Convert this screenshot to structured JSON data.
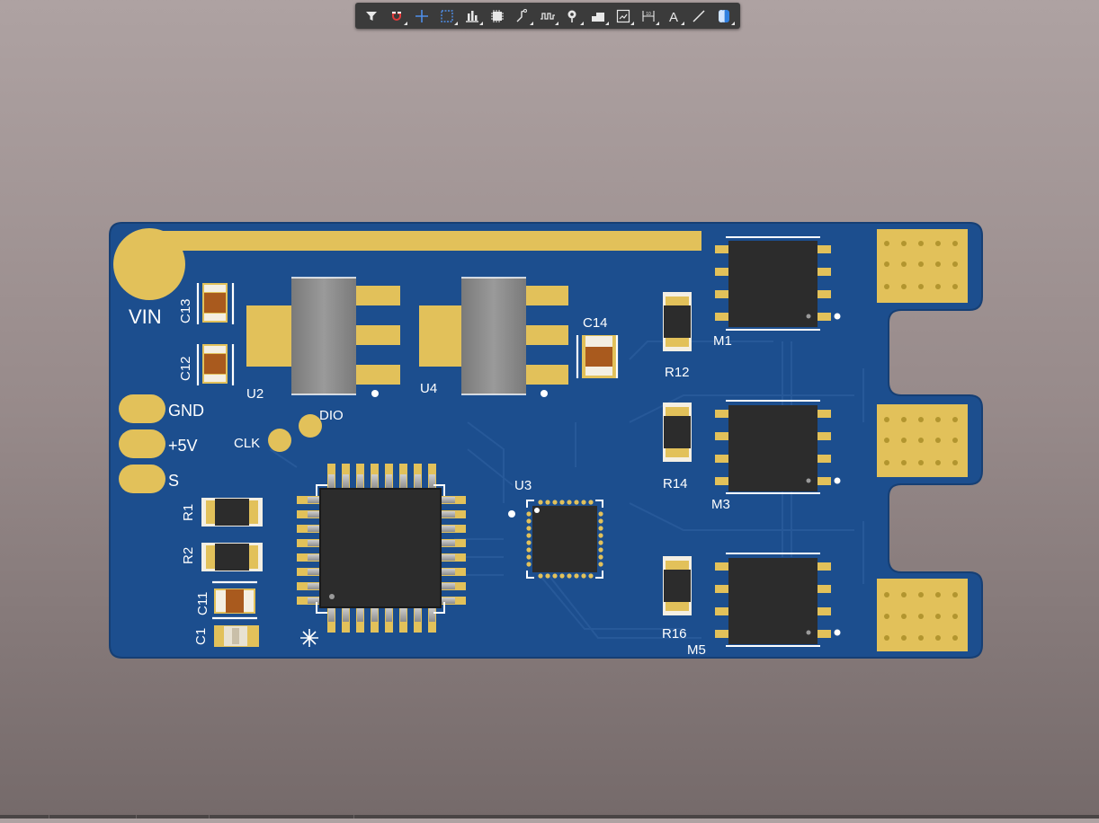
{
  "toolbar": {
    "tools": [
      {
        "id": "filter",
        "icon": "filter-icon",
        "has_menu": false
      },
      {
        "id": "snap",
        "icon": "magnet-icon",
        "has_menu": true
      },
      {
        "id": "place",
        "icon": "crosshair-icon",
        "has_menu": false
      },
      {
        "id": "select",
        "icon": "select-rect-icon",
        "has_menu": true
      },
      {
        "id": "align",
        "icon": "align-icon",
        "has_menu": true
      },
      {
        "id": "component",
        "icon": "component-icon",
        "has_menu": false
      },
      {
        "id": "route",
        "icon": "route-icon",
        "has_menu": true
      },
      {
        "id": "tune",
        "icon": "length-tune-icon",
        "has_menu": true
      },
      {
        "id": "via",
        "icon": "via-icon",
        "has_menu": true
      },
      {
        "id": "polygon",
        "icon": "polygon-icon",
        "has_menu": true
      },
      {
        "id": "region",
        "icon": "region-icon",
        "has_menu": true
      },
      {
        "id": "dimension",
        "icon": "dimension-icon",
        "has_menu": true
      },
      {
        "id": "text",
        "icon": "text-icon",
        "has_menu": true
      },
      {
        "id": "line",
        "icon": "line-icon",
        "has_menu": false
      },
      {
        "id": "view3d",
        "icon": "3d-body-icon",
        "has_menu": true
      }
    ]
  },
  "colors": {
    "board": "#1d4f8f",
    "board_dark": "#174175",
    "copper": "#e2c15a",
    "chip": "#2c2c2c",
    "capacitor": "#a95a1e",
    "regulator": "#8a8a8a",
    "silkscreen": "#ffffff"
  },
  "board": {
    "labels": {
      "vin": "VIN",
      "gnd": "GND",
      "v5": "+5V",
      "s": "S",
      "clk": "CLK",
      "dio": "DIO"
    },
    "designators": {
      "c13": "C13",
      "c12": "C12",
      "c14": "C14",
      "c11": "C11",
      "c1": "C1",
      "u2": "U2",
      "u4": "U4",
      "u3": "U3",
      "r1": "R1",
      "r2": "R2",
      "r12": "R12",
      "r14": "R14",
      "r16": "R16",
      "m1": "M1",
      "m3": "M3",
      "m5": "M5"
    }
  }
}
